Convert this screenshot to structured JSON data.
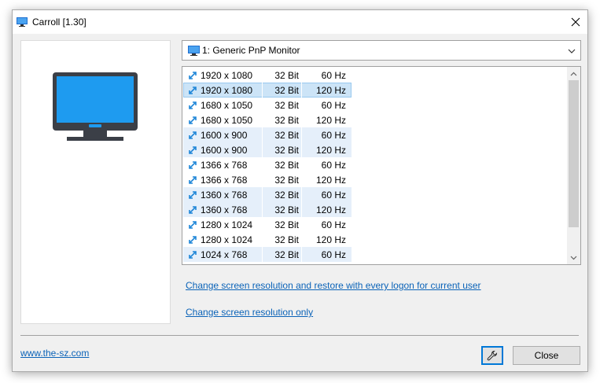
{
  "window": {
    "title": "Carroll [1.30]",
    "close_glyph": "✕",
    "accent_color": "#0078d7"
  },
  "monitor_select": {
    "selected": "1: Generic PnP Monitor",
    "icon": "monitor-icon"
  },
  "modes": [
    {
      "resolution": "1920 x 1080",
      "bits": "32 Bit",
      "hz": "60 Hz"
    },
    {
      "resolution": "1920 x 1080",
      "bits": "32 Bit",
      "hz": "120 Hz"
    },
    {
      "resolution": "1680 x 1050",
      "bits": "32 Bit",
      "hz": "60 Hz"
    },
    {
      "resolution": "1680 x 1050",
      "bits": "32 Bit",
      "hz": "120 Hz"
    },
    {
      "resolution": "1600 x 900",
      "bits": "32 Bit",
      "hz": "60 Hz"
    },
    {
      "resolution": "1600 x 900",
      "bits": "32 Bit",
      "hz": "120 Hz"
    },
    {
      "resolution": "1366 x 768",
      "bits": "32 Bit",
      "hz": "60 Hz"
    },
    {
      "resolution": "1366 x 768",
      "bits": "32 Bit",
      "hz": "120 Hz"
    },
    {
      "resolution": "1360 x 768",
      "bits": "32 Bit",
      "hz": "60 Hz"
    },
    {
      "resolution": "1360 x 768",
      "bits": "32 Bit",
      "hz": "120 Hz"
    },
    {
      "resolution": "1280 x 1024",
      "bits": "32 Bit",
      "hz": "60 Hz"
    },
    {
      "resolution": "1280 x 1024",
      "bits": "32 Bit",
      "hz": "120 Hz"
    },
    {
      "resolution": "1024 x 768",
      "bits": "32 Bit",
      "hz": "60 Hz"
    }
  ],
  "links": {
    "restore_every_logon": "Change screen resolution and restore with every logon for current user",
    "resolution_only": "Change screen resolution only",
    "website": "www.the-sz.com"
  },
  "buttons": {
    "tools_icon": "wrench-icon",
    "close": "Close"
  }
}
